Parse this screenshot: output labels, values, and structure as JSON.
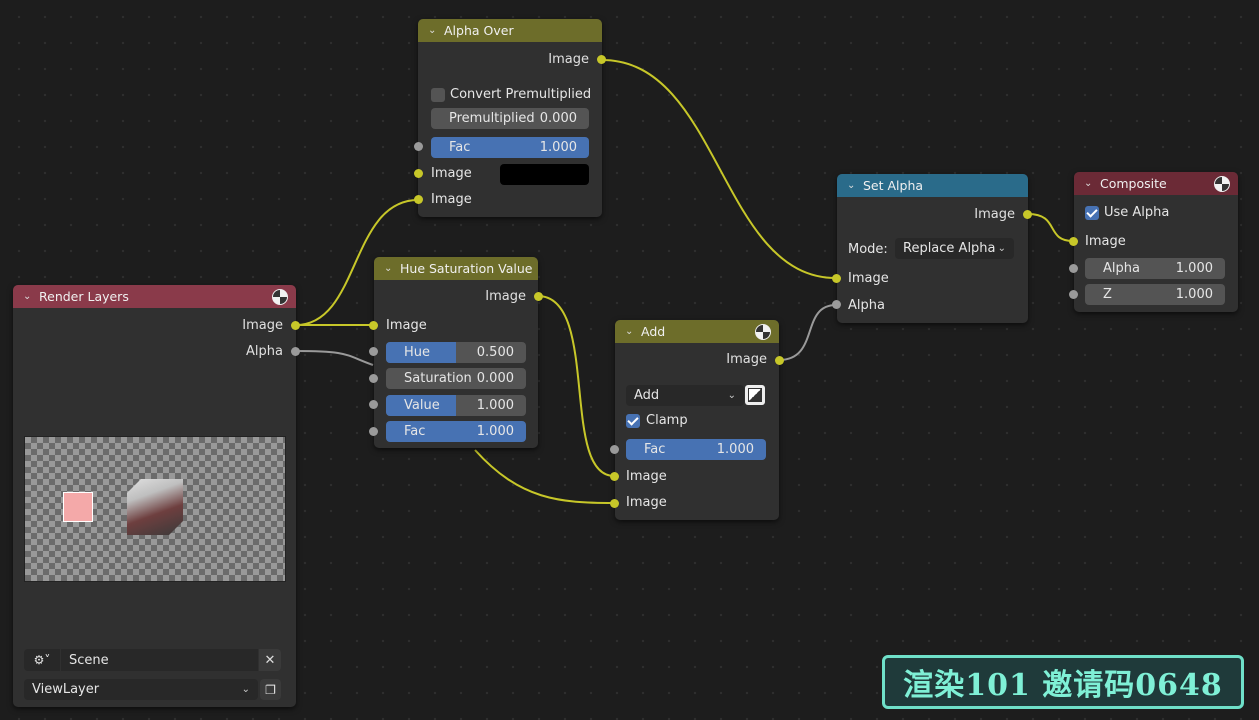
{
  "nodes": {
    "alpha_over": {
      "title": "Alpha Over",
      "output_image": "Image",
      "convert_premultiplied": "Convert Premultiplied",
      "premultiplied_label": "Premultiplied",
      "premultiplied_value": "0.000",
      "fac_label": "Fac",
      "fac_value": "1.000",
      "input_image_1": "Image",
      "input_image_2": "Image",
      "header_color": "#6d6d2a"
    },
    "render_layers": {
      "title": "Render Layers",
      "output_image": "Image",
      "output_alpha": "Alpha",
      "scene": "Scene",
      "view_layer": "ViewLayer",
      "header_color": "#8a3a4a"
    },
    "hue_saturation_value": {
      "title": "Hue Saturation Value",
      "output_image": "Image",
      "input_image": "Image",
      "hue_label": "Hue",
      "hue_value": "0.500",
      "hue_fraction": 0.5,
      "saturation_label": "Saturation",
      "saturation_value": "0.000",
      "value_label": "Value",
      "value_value": "1.000",
      "value_fraction": 0.5,
      "fac_label": "Fac",
      "fac_value": "1.000",
      "header_color": "#6d6d2a"
    },
    "add": {
      "title": "Add",
      "output_image": "Image",
      "blend_mode": "Add",
      "clamp_label": "Clamp",
      "clamp_checked": true,
      "fac_label": "Fac",
      "fac_value": "1.000",
      "input_image_1": "Image",
      "input_image_2": "Image",
      "header_color": "#6d6d2a"
    },
    "set_alpha": {
      "title": "Set Alpha",
      "output_image": "Image",
      "mode_label": "Mode:",
      "mode_value": "Replace Alpha",
      "input_image": "Image",
      "input_alpha": "Alpha",
      "header_color": "#2a6b8a"
    },
    "composite": {
      "title": "Composite",
      "use_alpha_label": "Use Alpha",
      "use_alpha_checked": true,
      "input_image": "Image",
      "alpha_label": "Alpha",
      "alpha_value": "1.000",
      "z_label": "Z",
      "z_value": "1.000",
      "header_color": "#6b2a36"
    }
  },
  "watermark": "渲染101 邀请码0648",
  "colors": {
    "socket_image": "#c7c729",
    "socket_value": "#9a9a9a",
    "wire_image": "#c7c729",
    "wire_value": "#9a9a9a",
    "field_blue": "#4772b3"
  }
}
